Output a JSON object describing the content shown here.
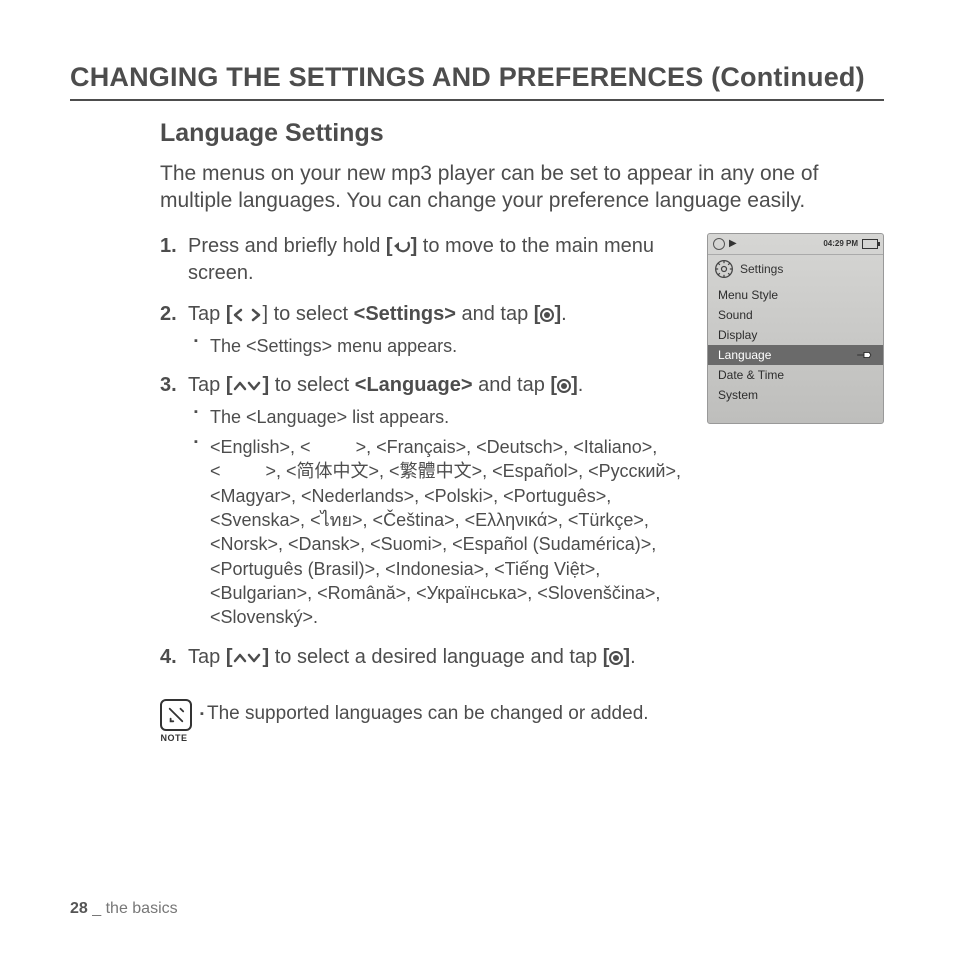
{
  "page_title": "CHANGING THE SETTINGS AND PREFERENCES (Continued)",
  "section_title": "Language Settings",
  "intro": "The menus on your new mp3 player can be set to appear in any one of multiple languages. You can change your preference language easily.",
  "steps": {
    "s1_a": "Press and briefly hold ",
    "s1_b": " to move to the main menu screen.",
    "s2_a": "Tap ",
    "s2_b": " to select ",
    "s2_settings": "<Settings>",
    "s2_c": " and tap ",
    "s2_sub": "The <Settings> menu appears.",
    "s3_a": "Tap ",
    "s3_b": " to select ",
    "s3_lang": "<Language>",
    "s3_c": " and tap ",
    "s3_sub1": "The <Language> list appears.",
    "s3_sub2": "<English>, <         >, <Français>, <Deutsch>, <Italiano>, <         >, <简体中文>, <繁體中文>, <Español>, <Русский>, <Magyar>, <Nederlands>, <Polski>, <Português>, <Svenska>, <ไทย>, <Čeština>, <Ελληνικά>, <Türkçe>, <Norsk>, <Dansk>, <Suomi>, <Español (Sudamérica)>, <Português (Brasil)>, <Indonesia>, <Tiếng Việt>, <Bulgarian>, <Română>, <Українська>, <Slovenščina>, <Slovenský>.",
    "s4_a": "Tap ",
    "s4_b": " to select a desired language and tap "
  },
  "note": {
    "label": "NOTE",
    "text": "The supported languages can be changed or added."
  },
  "device": {
    "time": "04:29 PM",
    "header": "Settings",
    "items": [
      "Menu Style",
      "Sound",
      "Display",
      "Language",
      "Date & Time",
      "System"
    ],
    "selected_index": 3
  },
  "footer": {
    "page_number": "28",
    "separator": " _ ",
    "section": "the basics"
  }
}
